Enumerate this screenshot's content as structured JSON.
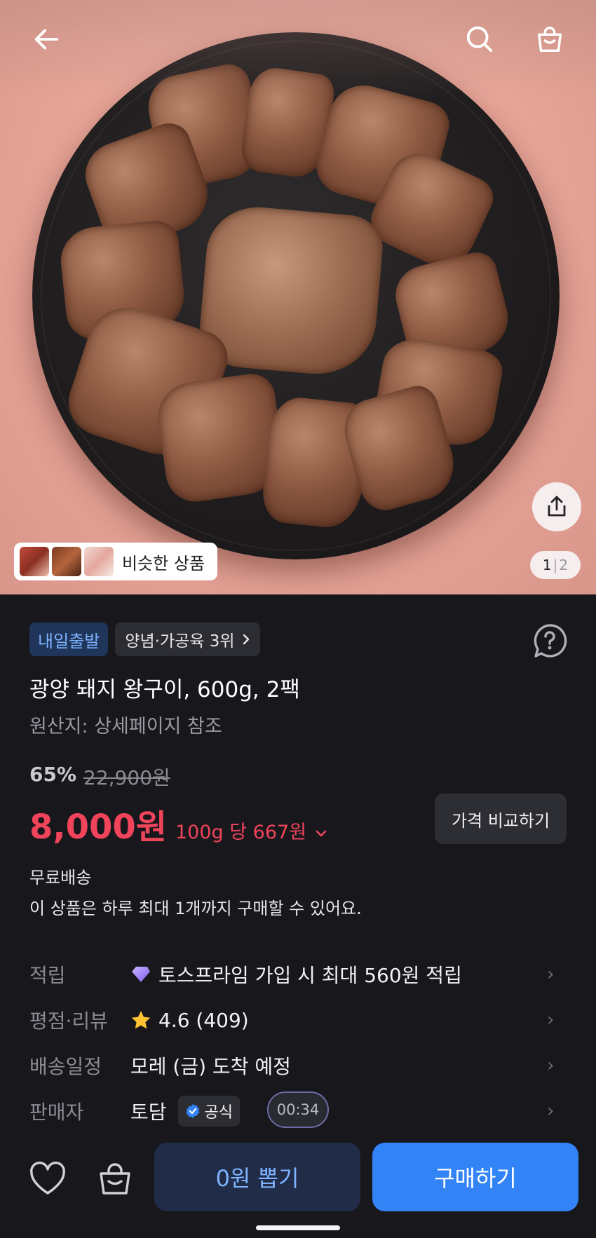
{
  "hero": {
    "similar_label": "비슷한 상품",
    "pager_current": "1",
    "pager_sep": "|",
    "pager_total": "2"
  },
  "product": {
    "badge_delivery": "내일출발",
    "badge_rank": "양념·가공육 3위",
    "title": "광양 돼지 왕구이, 600g, 2팩",
    "origin": "원산지: 상세페이지 참조",
    "discount": "65%",
    "original_price": "22,900원",
    "price": "8,000원",
    "unit_price": "100g 당 667원",
    "compare_label": "가격 비교하기",
    "free_shipping": "무료배송",
    "purchase_limit": "이 상품은 하루 최대 1개까지 구매할 수 있어요."
  },
  "rows": {
    "points_label": "적립",
    "points_value": "토스프라임 가입 시 최대 560원 적립",
    "rating_label": "평점·리뷰",
    "rating_value": "4.6 (409)",
    "shipping_label": "배송일정",
    "shipping_value": "모레 (금) 도착 예정",
    "seller_label": "판매자",
    "seller_value": "토담",
    "official_label": "공식"
  },
  "timer": "00:34",
  "bottom": {
    "draw_label": "0원 뽑기",
    "buy_label": "구매하기"
  },
  "colors": {
    "accent_blue": "#3183f6",
    "price_red": "#f0445a",
    "background": "#17171c"
  },
  "icons": [
    "back-arrow-icon",
    "search-icon",
    "shopping-bag-icon",
    "share-icon",
    "help-icon",
    "chevron-right-icon",
    "chevron-down-icon",
    "prime-gem-icon",
    "star-icon",
    "verified-check-icon",
    "heart-icon",
    "cart-bag-icon"
  ]
}
